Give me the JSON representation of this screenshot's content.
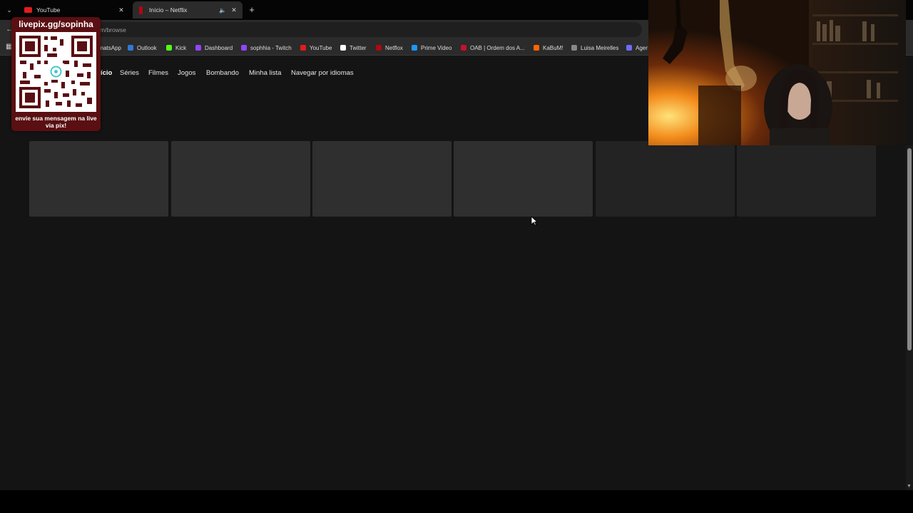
{
  "browser": {
    "tabs": [
      {
        "title": "YouTube",
        "favicon": "youtube-icon",
        "color": "#e21c1c"
      },
      {
        "title": "Início – Netflix",
        "favicon": "netflix-icon",
        "color": "#b20710",
        "active": true
      }
    ],
    "url": "m/browse",
    "bookmarks": [
      {
        "label": "natsApp",
        "icon": "whatsapp-icon",
        "color": "#25d366"
      },
      {
        "label": "Outlook",
        "icon": "outlook-icon",
        "color": "#2f7ad8"
      },
      {
        "label": "Kick",
        "icon": "kick-icon",
        "color": "#53fc18"
      },
      {
        "label": "Dashboard",
        "icon": "twitch-icon",
        "color": "#9146ff"
      },
      {
        "label": "sophhia - Twitch",
        "icon": "twitch-icon",
        "color": "#9146ff"
      },
      {
        "label": "YouTube",
        "icon": "youtube-icon",
        "color": "#e21c1c"
      },
      {
        "label": "Twitter",
        "icon": "x-icon",
        "color": "#ffffff"
      },
      {
        "label": "Netflox",
        "icon": "netflix-icon",
        "color": "#b20710"
      },
      {
        "label": "Prime Video",
        "icon": "prime-video-icon",
        "color": "#1a98ff"
      },
      {
        "label": "OAB | Ordem dos A...",
        "icon": "oab-icon",
        "color": "#c8102e"
      },
      {
        "label": "KaBuM!",
        "icon": "kabum-icon",
        "color": "#ff6500"
      },
      {
        "label": "Luisa Meirelles",
        "icon": "site-icon",
        "color": "#888888"
      },
      {
        "label": "Ager",
        "icon": "site-icon",
        "color": "#6c6cff"
      }
    ]
  },
  "netflix": {
    "nav": [
      "ício",
      "Séries",
      "Filmes",
      "Jogos",
      "Bombando",
      "Minha lista",
      "Navegar por idiomas"
    ],
    "placeholder_tiles": 6
  },
  "overlay": {
    "qr_title": "livepix.gg/sopinha",
    "qr_caption": "envie sua mensagem na live via pix!",
    "qr_color": "#5a0f12"
  },
  "colors": {
    "background": "#141414",
    "tile": "#2f2f2f",
    "accent": "#e50914"
  }
}
